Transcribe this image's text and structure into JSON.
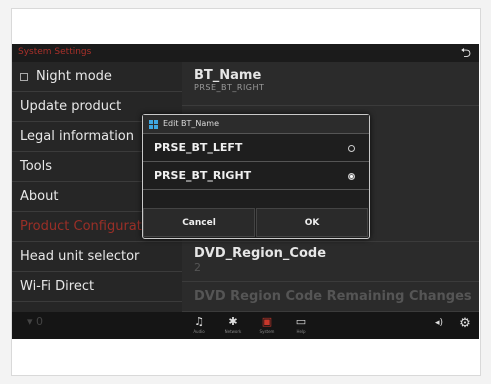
{
  "header": {
    "title": "System Settings",
    "back_glyph": "⮌"
  },
  "sidebar": {
    "items": [
      {
        "label": "Night mode"
      },
      {
        "label": "Update product"
      },
      {
        "label": "Legal information"
      },
      {
        "label": "Tools"
      },
      {
        "label": "About"
      },
      {
        "label": "Product Configuration",
        "section": true
      },
      {
        "label": "Head unit selector"
      },
      {
        "label": "Wi-Fi Direct"
      }
    ]
  },
  "main": {
    "bt_name": {
      "title": "BT_Name",
      "value": "PRSE_BT_RIGHT"
    },
    "dvd_region": {
      "title": "DVD_Region_Code",
      "value": "2"
    },
    "dvd_remaining": {
      "title": "DVD Region Code Remaining Changes"
    }
  },
  "dialog": {
    "title": "Edit BT_Name",
    "options": [
      {
        "label": "PRSE_BT_LEFT",
        "selected": false
      },
      {
        "label": "PRSE_BT_RIGHT",
        "selected": true
      }
    ],
    "cancel": "Cancel",
    "ok": "OK"
  },
  "bottombar": {
    "items": [
      {
        "label": "Audio",
        "icon": "music-note-icon",
        "glyph": "♫"
      },
      {
        "label": "Network",
        "icon": "network-icon",
        "glyph": "✱"
      },
      {
        "label": "System",
        "icon": "system-icon",
        "glyph": "▣"
      },
      {
        "label": "Help",
        "icon": "help-icon",
        "glyph": "▭"
      }
    ],
    "left_glyph": "▾ 0",
    "volume_glyph": "◂)",
    "gear_glyph": "⚙"
  },
  "colors": {
    "accent": "#c8372b",
    "background": "#262626"
  }
}
